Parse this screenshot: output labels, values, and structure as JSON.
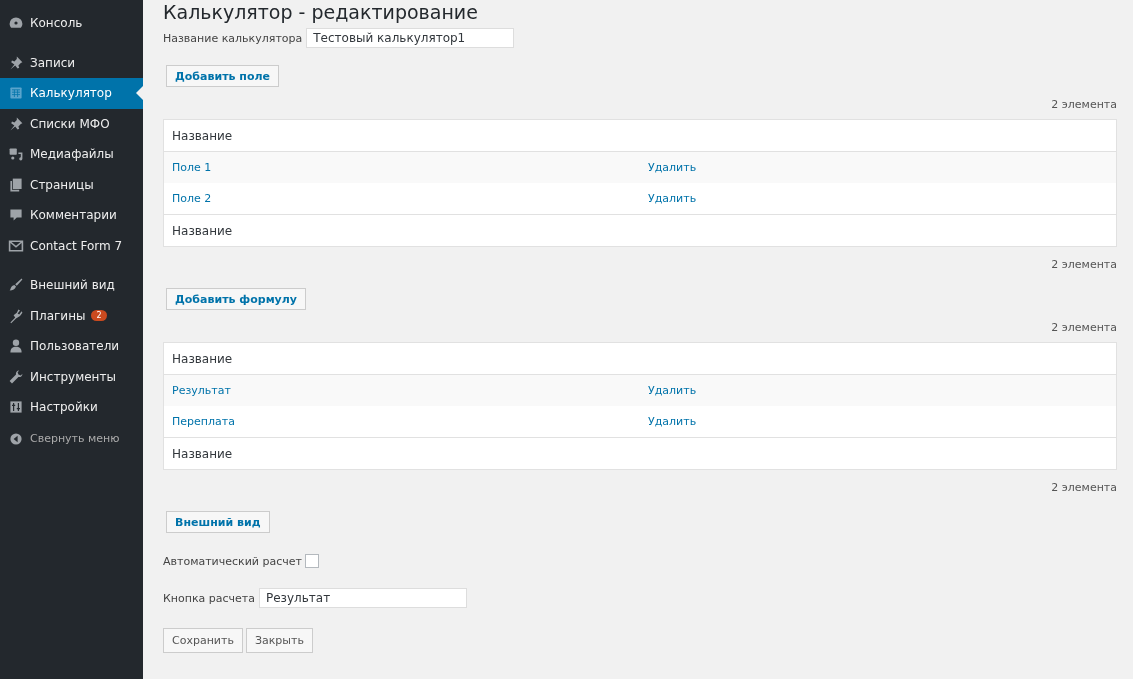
{
  "sidebar": {
    "groups": [
      [
        {
          "label": "Консоль",
          "selected": false
        }
      ],
      [
        {
          "label": "Записи",
          "selected": false
        },
        {
          "label": "Калькулятор",
          "selected": true
        },
        {
          "label": "Списки МФО",
          "selected": false
        },
        {
          "label": "Медиафайлы",
          "selected": false
        },
        {
          "label": "Страницы",
          "selected": false
        },
        {
          "label": "Комментарии",
          "selected": false
        },
        {
          "label": "Contact Form 7",
          "selected": false
        }
      ],
      [
        {
          "label": "Внешний вид",
          "selected": false
        },
        {
          "label": "Плагины",
          "selected": false,
          "badge": "2"
        },
        {
          "label": "Пользователи",
          "selected": false
        },
        {
          "label": "Инструменты",
          "selected": false
        },
        {
          "label": "Настройки",
          "selected": false
        }
      ]
    ],
    "collapse": "Свернуть меню"
  },
  "title": "Калькулятор - редактирование",
  "name_field": {
    "label": "Название калькулятора",
    "value": "Тестовый калькулятор1"
  },
  "sections": [
    {
      "button": "Добавить поле",
      "count_top": "2 элемента",
      "header": "Название",
      "rows": [
        {
          "name": "Поле 1",
          "action": "Удалить"
        },
        {
          "name": "Поле 2",
          "action": "Удалить"
        }
      ],
      "footer": "Название",
      "count_bottom": "2 элемента"
    },
    {
      "button": "Добавить формулу",
      "count_top": "2 элемента",
      "header": "Название",
      "rows": [
        {
          "name": "Результат",
          "action": "Удалить"
        },
        {
          "name": "Переплата",
          "action": "Удалить"
        }
      ],
      "footer": "Название",
      "count_bottom": "2 элемента"
    }
  ],
  "appearance_button": "Внешний вид",
  "auto_calc": {
    "label": "Автоматический расчет",
    "checked": false
  },
  "calc_button_field": {
    "label": "Кнопка расчета",
    "value": "Результат"
  },
  "buttons": [
    "Сохранить",
    "Закрыть"
  ]
}
